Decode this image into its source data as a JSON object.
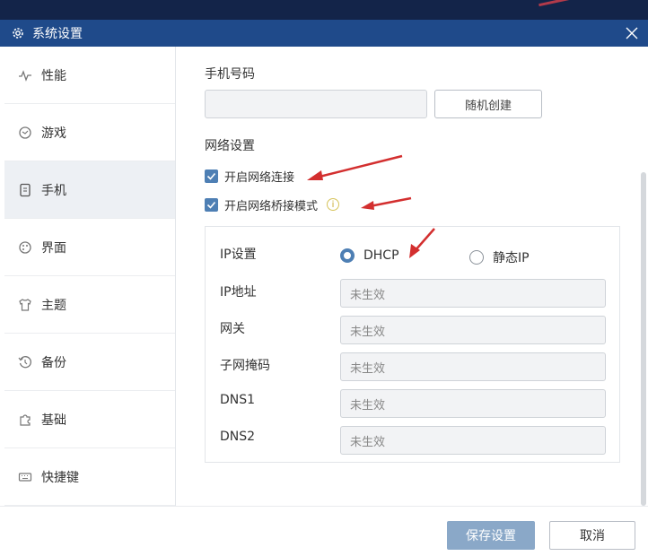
{
  "window": {
    "title": "系统设置"
  },
  "sidebar": {
    "items": [
      {
        "label": "性能",
        "icon": "pulse-icon"
      },
      {
        "label": "游戏",
        "icon": "gamepad-icon"
      },
      {
        "label": "手机",
        "icon": "phone-icon",
        "active": true
      },
      {
        "label": "界面",
        "icon": "palette-icon"
      },
      {
        "label": "主题",
        "icon": "shirt-icon"
      },
      {
        "label": "备份",
        "icon": "backup-icon"
      },
      {
        "label": "基础",
        "icon": "puzzle-icon"
      },
      {
        "label": "快捷键",
        "icon": "keyboard-icon"
      }
    ]
  },
  "phone": {
    "section_label": "手机号码",
    "number_value": "",
    "random_button": "随机创建"
  },
  "network": {
    "section_label": "网络设置",
    "enable_network": {
      "label": "开启网络连接",
      "checked": true
    },
    "bridge_mode": {
      "label": "开启网络桥接模式",
      "checked": true
    },
    "ip": {
      "label": "IP设置",
      "options": [
        {
          "label": "DHCP",
          "selected": true
        },
        {
          "label": "静态IP",
          "selected": false
        }
      ],
      "fields": [
        {
          "label": "IP地址",
          "value": "未生效"
        },
        {
          "label": "网关",
          "value": "未生效"
        },
        {
          "label": "子网掩码",
          "value": "未生效"
        },
        {
          "label": "DNS1",
          "value": "未生效"
        },
        {
          "label": "DNS2",
          "value": "未生效"
        }
      ]
    }
  },
  "footer": {
    "save_label": "保存设置",
    "cancel_label": "取消"
  },
  "colors": {
    "titlebar": "#1f4a8a",
    "accent": "#4e7fb4",
    "save_button": "#8aa8c8",
    "annotation_arrow": "#d32f2f"
  }
}
